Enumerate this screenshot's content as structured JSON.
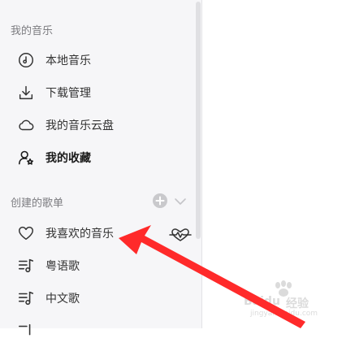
{
  "sidebar": {
    "my_music_title": "我的音乐",
    "my_music_items": [
      {
        "label": "本地音乐",
        "icon": "music-note-circle-icon"
      },
      {
        "label": "下载管理",
        "icon": "download-icon"
      },
      {
        "label": "我的音乐云盘",
        "icon": "cloud-icon"
      },
      {
        "label": "我的收藏",
        "icon": "user-star-icon"
      }
    ],
    "created_playlists_title": "创建的歌单",
    "playlists": [
      {
        "label": "我喜欢的音乐",
        "icon": "heart-icon"
      },
      {
        "label": "粤语歌",
        "icon": "playlist-icon"
      },
      {
        "label": "中文歌",
        "icon": "playlist-icon"
      }
    ]
  },
  "watermark": {
    "line1": "Baidu",
    "line2": "经验",
    "line3": "jingyan.baidu.com"
  },
  "colors": {
    "sidebar_bg": "#f6f6f8",
    "annotation_arrow": "#ff2a2a"
  }
}
